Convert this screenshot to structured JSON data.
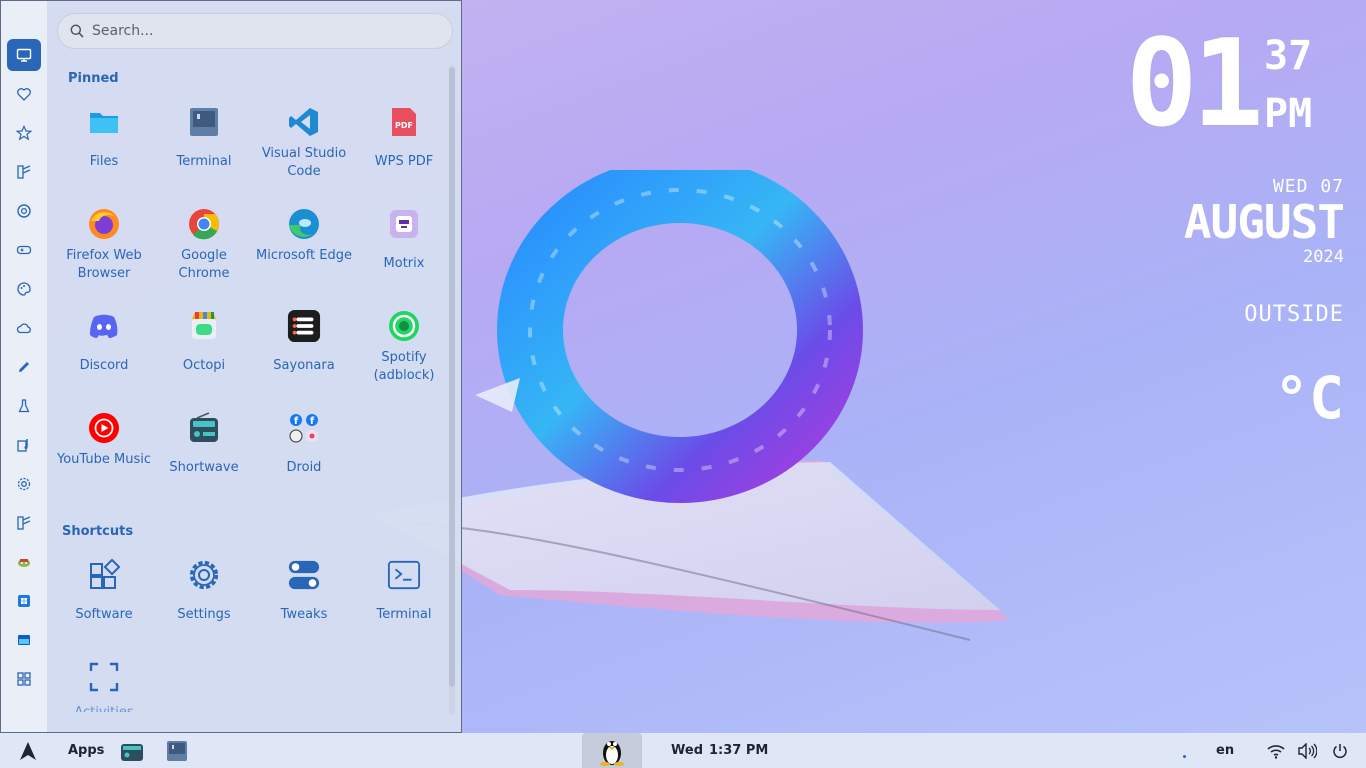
{
  "desktop": {
    "clock": {
      "hour": "01",
      "minute": "37",
      "ampm": "PM"
    },
    "date": {
      "weekday_day": "WED 07",
      "month": "AUGUST",
      "year": "2024"
    },
    "weather": {
      "location": "OUTSIDE",
      "temperature": "°C"
    }
  },
  "menu": {
    "search": {
      "placeholder": "Search..."
    },
    "categories": [
      {
        "icon": "monitor-icon",
        "active": true
      },
      {
        "icon": "heart-icon"
      },
      {
        "icon": "star-icon"
      },
      {
        "icon": "film-icon"
      },
      {
        "icon": "globe-icon"
      },
      {
        "icon": "gamepad-icon"
      },
      {
        "icon": "palette-icon"
      },
      {
        "icon": "cloud-icon"
      },
      {
        "icon": "pencil-icon"
      },
      {
        "icon": "flask-icon"
      },
      {
        "icon": "music-icon"
      },
      {
        "icon": "gear-icon"
      },
      {
        "icon": "film-icon"
      },
      {
        "icon": "wine-icon"
      },
      {
        "icon": "windows-icon"
      },
      {
        "icon": "windows-blue-icon"
      },
      {
        "icon": "grid-icon"
      }
    ],
    "pinned_title": "Pinned",
    "pinned": [
      {
        "label": "Files",
        "icon": "folder-icon"
      },
      {
        "label": "Terminal",
        "icon": "terminal-icon"
      },
      {
        "label": "Visual Studio Code",
        "icon": "vscode-icon"
      },
      {
        "label": "WPS PDF",
        "icon": "pdf-icon"
      },
      {
        "label": "Firefox Web Browser",
        "icon": "firefox-icon"
      },
      {
        "label": "Google Chrome",
        "icon": "chrome-icon"
      },
      {
        "label": "Microsoft Edge",
        "icon": "edge-icon"
      },
      {
        "label": "Motrix",
        "icon": "motrix-icon"
      },
      {
        "label": "Discord",
        "icon": "discord-icon"
      },
      {
        "label": "Octopi",
        "icon": "octopi-icon"
      },
      {
        "label": "Sayonara",
        "icon": "sayonara-icon"
      },
      {
        "label": "Spotify (adblock)",
        "icon": "spotify-icon"
      },
      {
        "label": "YouTube Music",
        "icon": "youtube-music-icon"
      },
      {
        "label": "Shortwave",
        "icon": "radio-icon"
      },
      {
        "label": "Droid",
        "icon": "droid-icon"
      }
    ],
    "shortcuts_title": "Shortcuts",
    "shortcuts": [
      {
        "label": "Software",
        "icon": "software-icon"
      },
      {
        "label": "Settings",
        "icon": "settings-gear-icon"
      },
      {
        "label": "Tweaks",
        "icon": "toggle-icon"
      },
      {
        "label": "Terminal",
        "icon": "terminal-prompt-icon"
      },
      {
        "label": "Activities",
        "icon": "activities-icon"
      }
    ],
    "accent": "#2a66b8"
  },
  "taskbar": {
    "apps_label": "Apps",
    "weekday": "Wed",
    "time": "1:37 PM",
    "language": "en"
  }
}
